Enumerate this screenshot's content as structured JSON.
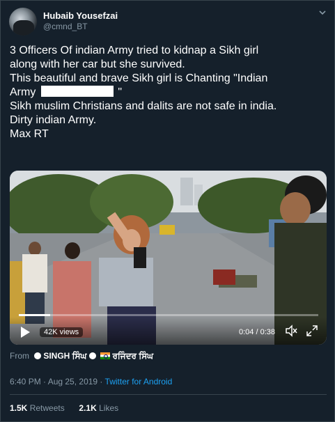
{
  "author": {
    "name": "Hubaib Yousefzai",
    "handle": "@cmnd_BT"
  },
  "tweet": {
    "lines": [
      "3 Officers Of indian Army tried to kidnap a Sikh girl",
      "along with her car but she survived.",
      "This beautiful and brave Sikh girl is Chanting \"Indian",
      "Army",
      "\"",
      "Sikh muslim Christians and dalits are not safe in india.",
      "Dirty indian Army.",
      "Max RT"
    ]
  },
  "video": {
    "views": "42K views",
    "time": "0:04 / 0:38",
    "progress": 0.105
  },
  "source": {
    "prefix": "From",
    "name_part1": "SINGH ਸਿੰਘ",
    "name_part2": "ਰਜਿੰਦਰ ਸਿੰਘ"
  },
  "meta": {
    "timestamp": "6:40 PM · Aug 25, 2019 ·",
    "app": "Twitter for Android"
  },
  "stats": {
    "retweets_count": "1.5K",
    "retweets_label": "Retweets",
    "likes_count": "2.1K",
    "likes_label": "Likes"
  },
  "icons": {
    "caret": "chevron-down-icon",
    "play": "play-icon",
    "mute": "mute-icon",
    "expand": "expand-icon"
  },
  "colors": {
    "background": "#15202b",
    "secondary_text": "#8899a6",
    "link": "#1da1f2",
    "border": "#38444d"
  }
}
